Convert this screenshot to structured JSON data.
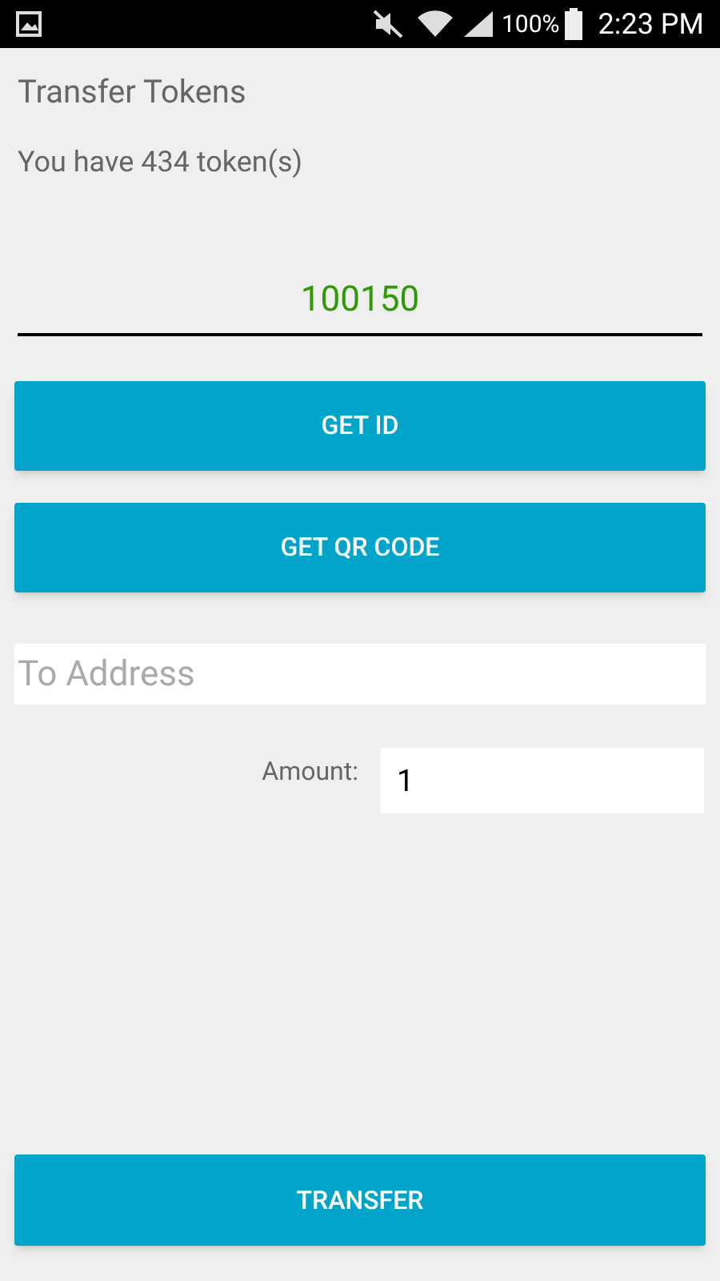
{
  "status_bar": {
    "battery_text": "100%",
    "time": "2:23 PM"
  },
  "title": "Transfer Tokens",
  "balance": "You have 434 token(s)",
  "id_field": {
    "value": "100150"
  },
  "buttons": [
    {
      "label": "GET ID"
    },
    {
      "label": "GET QR CODE"
    }
  ],
  "address_field": {
    "placeholder": "To Address"
  },
  "amount": {
    "label": "Amount:",
    "value": "1"
  },
  "submit_button": {
    "label": "TRANSFER"
  }
}
